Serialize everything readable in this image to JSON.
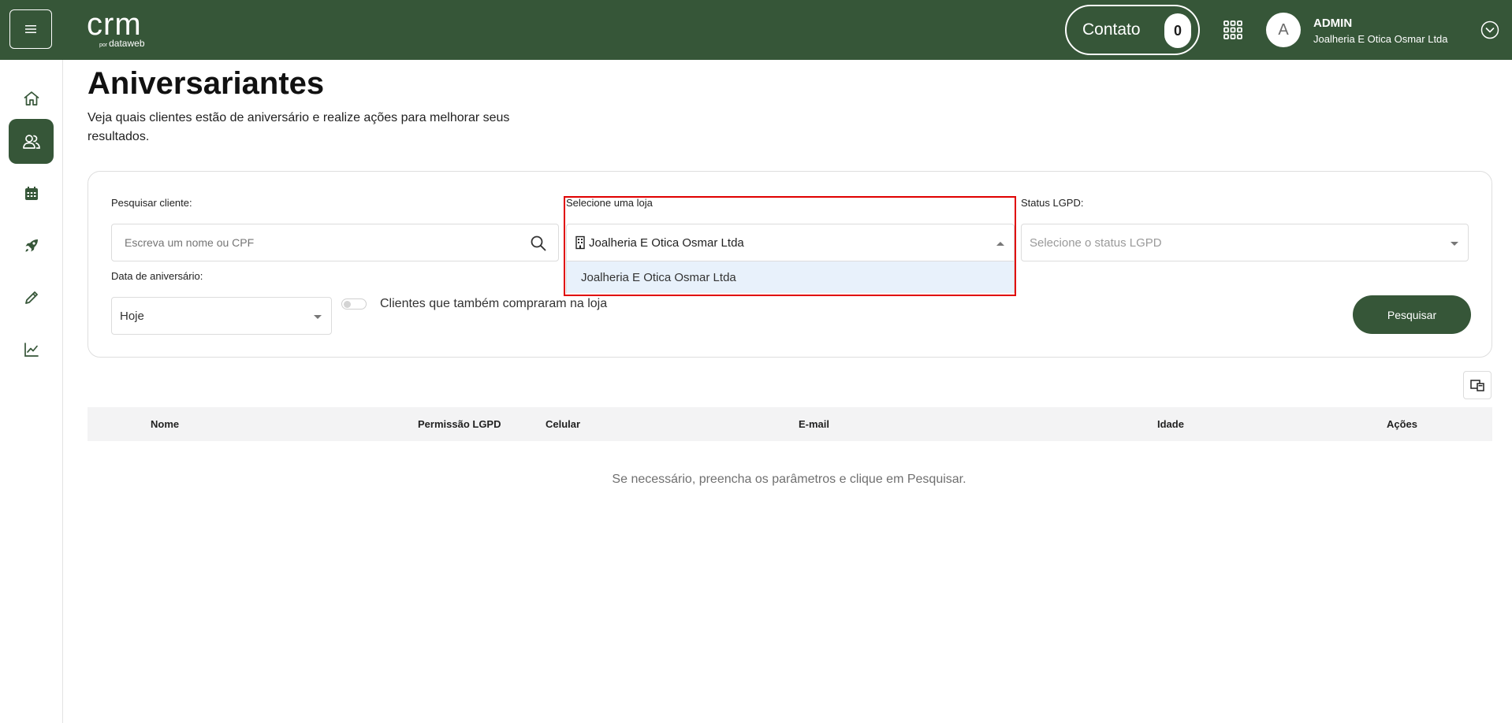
{
  "header": {
    "logo_main": "crm",
    "logo_sub_prefix": "por",
    "logo_sub": "dataweb",
    "contato_label": "Contato",
    "contato_count": "0",
    "avatar_letter": "A",
    "user_name": "ADMIN",
    "user_company": "Joalheria E Otica Osmar Ltda",
    "brand_color": "#365638"
  },
  "sidebar": {
    "items": [
      {
        "name": "home",
        "icon": "home-icon",
        "active": false
      },
      {
        "name": "clients",
        "icon": "users-icon",
        "active": true
      },
      {
        "name": "calendar",
        "icon": "calendar-icon",
        "active": false
      },
      {
        "name": "campaigns",
        "icon": "rocket-icon",
        "active": false
      },
      {
        "name": "edit",
        "icon": "pencil-icon",
        "active": false
      },
      {
        "name": "reports",
        "icon": "chart-line-icon",
        "active": false
      }
    ]
  },
  "page": {
    "title": "Aniversariantes",
    "description": "Veja quais clientes estão de aniversário e realize ações para melhorar seus resultados."
  },
  "filters": {
    "search_label": "Pesquisar cliente:",
    "search_placeholder": "Escreva um nome ou CPF",
    "store_label": "Selecione uma loja",
    "store_value": "Joalheria E Otica Osmar Ltda",
    "store_options": [
      "Joalheria E Otica Osmar Ltda"
    ],
    "lgpd_label": "Status LGPD:",
    "lgpd_placeholder": "Selecione o status LGPD",
    "date_label": "Data de aniversário:",
    "date_value": "Hoje",
    "toggle_label": "Clientes que também compraram na loja",
    "toggle_on": false,
    "search_button": "Pesquisar"
  },
  "table": {
    "columns": [
      "Nome",
      "Permissão LGPD",
      "Celular",
      "E-mail",
      "Idade",
      "Ações"
    ],
    "empty_message": "Se necessário, preencha os parâmetros e clique em Pesquisar."
  }
}
